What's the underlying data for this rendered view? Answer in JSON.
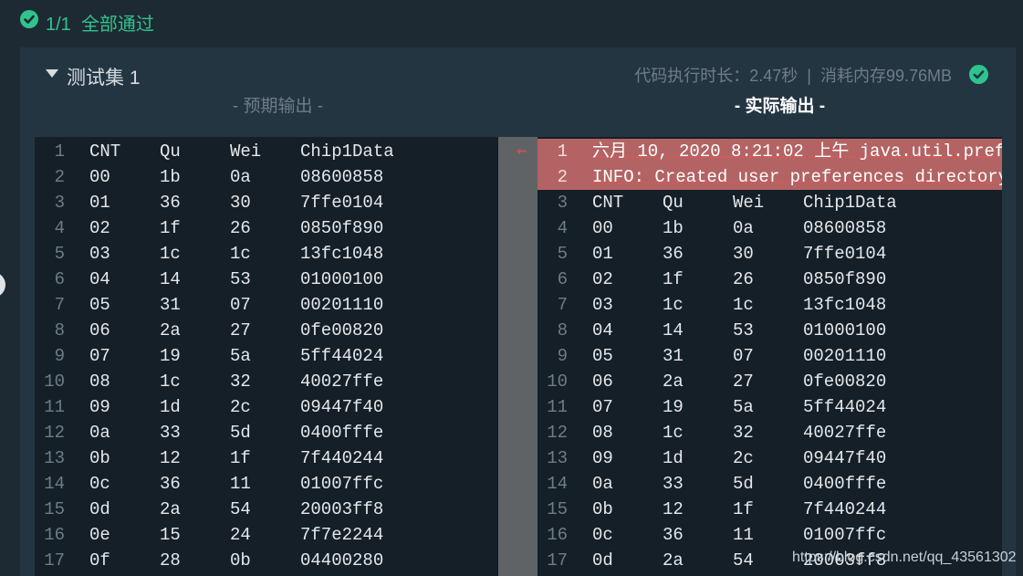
{
  "status": {
    "count": "1/1",
    "label": "全部通过",
    "color": "#2fc48d",
    "icon": "check-circle-icon"
  },
  "testset": {
    "title": "测试集 1",
    "stats": "代码执行时长：2.47秒  |  消耗内存99.76MB",
    "expected_label": "- 预期输出 -",
    "actual_label": "- 实际输出 -"
  },
  "expected_output": [
    [
      "CNT",
      "Qu",
      "Wei",
      "Chip1Data"
    ],
    [
      "00",
      "1b",
      "0a",
      "08600858"
    ],
    [
      "01",
      "36",
      "30",
      "7ffe0104"
    ],
    [
      "02",
      "1f",
      "26",
      "0850f890"
    ],
    [
      "03",
      "1c",
      "1c",
      "13fc1048"
    ],
    [
      "04",
      "14",
      "53",
      "01000100"
    ],
    [
      "05",
      "31",
      "07",
      "00201110"
    ],
    [
      "06",
      "2a",
      "27",
      "0fe00820"
    ],
    [
      "07",
      "19",
      "5a",
      "5ff44024"
    ],
    [
      "08",
      "1c",
      "32",
      "40027ffe"
    ],
    [
      "09",
      "1d",
      "2c",
      "09447f40"
    ],
    [
      "0a",
      "33",
      "5d",
      "0400fffe"
    ],
    [
      "0b",
      "12",
      "1f",
      "7f440244"
    ],
    [
      "0c",
      "36",
      "11",
      "01007ffc"
    ],
    [
      "0d",
      "2a",
      "54",
      "20003ff8"
    ],
    [
      "0e",
      "15",
      "24",
      "7f7e2244"
    ],
    [
      "0f",
      "28",
      "0b",
      "04400280"
    ]
  ],
  "actual_output": {
    "messages": [
      "六月 10, 2020 8:21:02 上午 java.util.pref",
      "INFO: Created user preferences directory."
    ],
    "rows": [
      [
        "CNT",
        "Qu",
        "Wei",
        "Chip1Data"
      ],
      [
        "00",
        "1b",
        "0a",
        "08600858"
      ],
      [
        "01",
        "36",
        "30",
        "7ffe0104"
      ],
      [
        "02",
        "1f",
        "26",
        "0850f890"
      ],
      [
        "03",
        "1c",
        "1c",
        "13fc1048"
      ],
      [
        "04",
        "14",
        "53",
        "01000100"
      ],
      [
        "05",
        "31",
        "07",
        "00201110"
      ],
      [
        "06",
        "2a",
        "27",
        "0fe00820"
      ],
      [
        "07",
        "19",
        "5a",
        "5ff44024"
      ],
      [
        "08",
        "1c",
        "32",
        "40027ffe"
      ],
      [
        "09",
        "1d",
        "2c",
        "09447f40"
      ],
      [
        "0a",
        "33",
        "5d",
        "0400fffe"
      ],
      [
        "0b",
        "12",
        "1f",
        "7f440244"
      ],
      [
        "0c",
        "36",
        "11",
        "01007ffc"
      ],
      [
        "0d",
        "2a",
        "54",
        "20003ff8"
      ]
    ]
  },
  "diff_marker": "⇜",
  "watermark": "https://blog.csdn.net/qq_43561302",
  "colors": {
    "highlight": "#b36363",
    "accent": "#2fc48d"
  }
}
